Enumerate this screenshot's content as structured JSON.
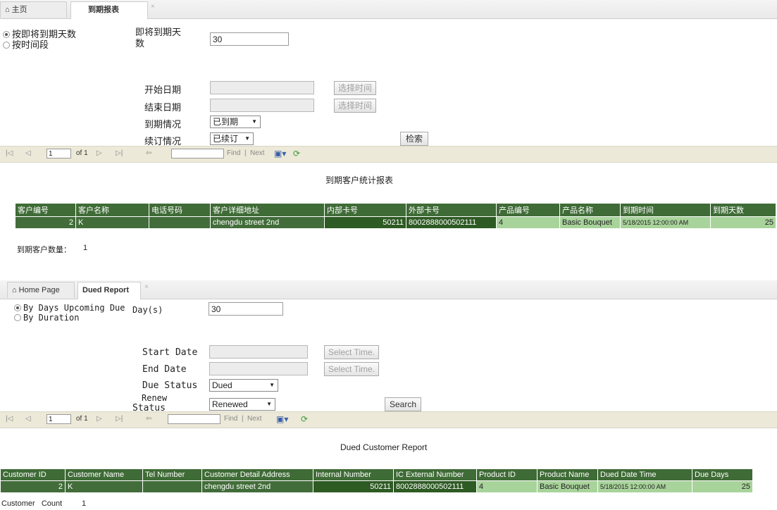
{
  "cn": {
    "tabs": {
      "home": "主页",
      "active": "到期报表",
      "close": "×"
    },
    "mode_options": [
      "按即将到期天数",
      "按时间段"
    ],
    "days_label": "即将到期天数",
    "days_value": "30",
    "start_date_label": "开始日期",
    "end_date_label": "结束日期",
    "select_time": "选择时间",
    "due_status_label": "到期情况",
    "due_status_value": "已到期",
    "renew_status_label": "续订情况",
    "renew_status_value": "已续订",
    "search_button": "检索",
    "toolbar": {
      "page": "1",
      "of": "of 1",
      "find": "Find",
      "sep": "|",
      "next": "Next"
    },
    "report_title": "到期客户统计报表",
    "columns": [
      "客户编号",
      "客户名称",
      "电话号码",
      "客户详细地址",
      "内部卡号",
      "外部卡号",
      "产品编号",
      "产品名称",
      "到期时间",
      "到期天数"
    ],
    "row": [
      "2",
      "K",
      "",
      "chengdu   street 2nd",
      "50211",
      "8002888000502111",
      "4",
      "Basic Bouquet",
      "5/18/2015 12:00:00 AM",
      "25"
    ],
    "count_label": "到期客户数量：",
    "count_value": "1"
  },
  "en": {
    "tabs": {
      "home": "Home Page",
      "active": "Dued Report",
      "close": "×"
    },
    "mode_options": [
      "By Days Upcoming Due",
      "By Duration"
    ],
    "days_label": "Day(s)",
    "days_value": "30",
    "start_date_label": "Start Date",
    "end_date_label": "End Date",
    "select_time": "Select Time.",
    "due_status_label": "Due Status",
    "due_status_value": "Dued",
    "renew_status_label_1": "Renew",
    "renew_status_label_2": "Status",
    "renew_status_value": "Renewed",
    "search_button": "Search",
    "toolbar": {
      "page": "1",
      "of": "of 1",
      "find": "Find",
      "sep": "|",
      "next": "Next"
    },
    "report_title": "Dued Customer Report",
    "columns": [
      "Customer ID",
      "Customer Name",
      "Tel Number",
      "Customer Detail Address",
      "Internal Number",
      "IC External Number",
      "Product ID",
      "Product Name",
      "Dued Date Time",
      "Due Days"
    ],
    "row": [
      "2",
      "K",
      "",
      "chengdu   street 2nd",
      "50211",
      "8002888000502111",
      "4",
      "Basic Bouquet",
      "5/18/2015 12:00:00 AM",
      "25"
    ],
    "count_label": "Customer   Count",
    "count_value": "1"
  },
  "colors": {
    "header_green": "#3f6b36",
    "dark_green": "#426d3a",
    "light_green": "#a8d39b",
    "toolbar_bg": "#ece9d8"
  }
}
